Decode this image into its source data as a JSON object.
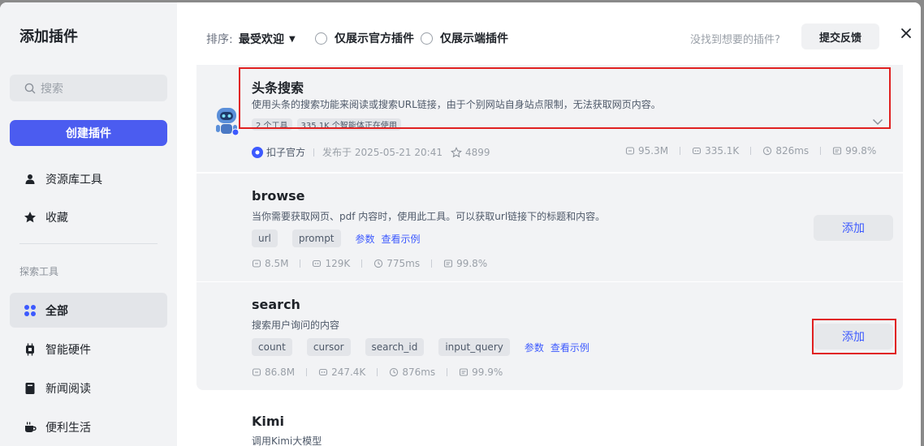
{
  "sidebar": {
    "title": "添加插件",
    "search_placeholder": "搜索",
    "create_label": "创建插件",
    "nav": [
      {
        "label": "资源库工具",
        "icon": "user-icon"
      },
      {
        "label": "收藏",
        "icon": "star-icon"
      }
    ],
    "section_label": "探索工具",
    "categories": [
      {
        "label": "全部",
        "icon": "grid-icon",
        "active": true
      },
      {
        "label": "智能硬件",
        "icon": "chip-icon"
      },
      {
        "label": "新闻阅读",
        "icon": "book-icon"
      },
      {
        "label": "便利生活",
        "icon": "cup-icon"
      }
    ]
  },
  "topbar": {
    "sort_label": "排序:",
    "sort_value": "最受欢迎",
    "filter_official": "仅展示官方插件",
    "filter_client": "仅展示端插件",
    "hint": "没找到想要的插件?",
    "feedback_label": "提交反馈"
  },
  "plugins": [
    {
      "title": "头条搜索",
      "desc": "使用头条的搜索功能来阅读或搜索URL链接，由于个别网站自身站点限制，无法获取网页内容。",
      "tags": [
        "2 个工具",
        "335.1K 个智能体正在使用"
      ],
      "publisher": "扣子官方",
      "published": "发布于 2025-05-21 20:41",
      "favorites": "4899",
      "stats": [
        "95.3M",
        "335.1K",
        "826ms",
        "99.8%"
      ]
    },
    {
      "title": "browse",
      "desc": "当你需要获取网页、pdf 内容时，使用此工具。可以获取url链接下的标题和内容。",
      "params": [
        "url",
        "prompt"
      ],
      "link_params": "参数",
      "link_examples": "查看示例",
      "stats": [
        "8.5M",
        "129K",
        "775ms",
        "99.8%"
      ],
      "add_label": "添加"
    },
    {
      "title": "search",
      "desc": "搜索用户询问的内容",
      "params": [
        "count",
        "cursor",
        "search_id",
        "input_query"
      ],
      "link_params": "参数",
      "link_examples": "查看示例",
      "stats": [
        "86.8M",
        "247.4K",
        "876ms",
        "99.9%"
      ],
      "add_label": "添加"
    },
    {
      "title": "Kimi",
      "desc": "调用Kimi大模型"
    }
  ]
}
